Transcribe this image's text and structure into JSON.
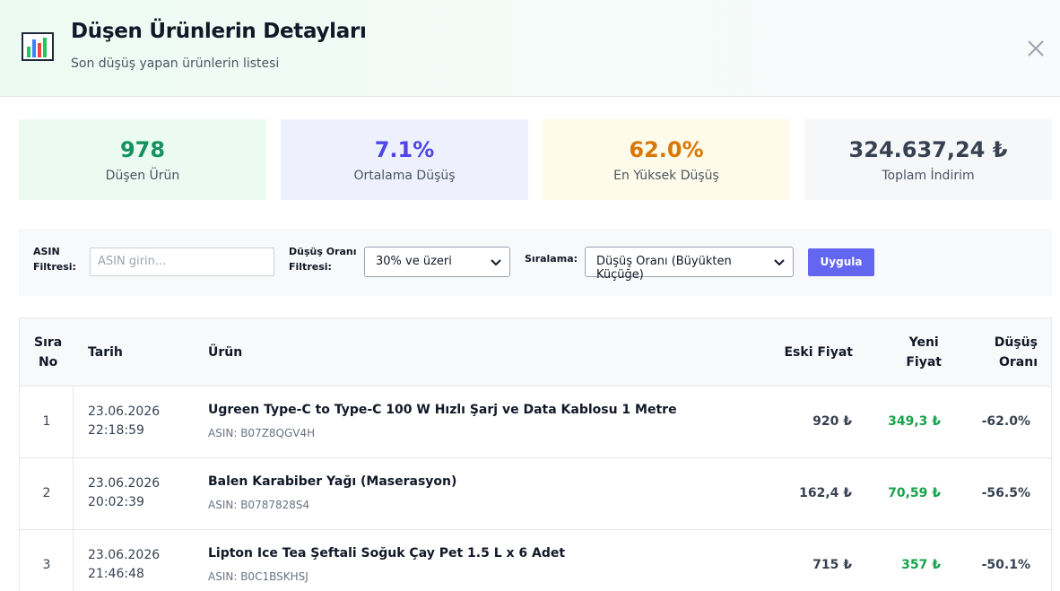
{
  "header": {
    "title": "Düşen Ürünlerin Detayları",
    "subtitle": "Son düşüş yapan ürünlerin listesi",
    "icon": "bar-chart-icon",
    "close_icon": "close-icon"
  },
  "stats": [
    {
      "value": "978",
      "label": "Düşen Ürün",
      "bg": "#ebfbf2",
      "color": "#15925e"
    },
    {
      "value": "7.1%",
      "label": "Ortalama Düşüş",
      "bg": "#eef1fd",
      "color": "#4f46e5"
    },
    {
      "value": "62.0%",
      "label": "En Yüksek Düşüş",
      "bg": "#fefbea",
      "color": "#d97706"
    },
    {
      "value": "324.637,24 ₺",
      "label": "Toplam İndirim",
      "bg": "#f6f7f9",
      "color": "#374151"
    }
  ],
  "filters": {
    "asin_label_1": "ASIN",
    "asin_label_2": "Filtresi:",
    "asin_placeholder": "ASIN girin...",
    "drop_label_1": "Düşüş Oranı",
    "drop_label_2": "Filtresi:",
    "drop_selected": "30% ve üzeri",
    "sort_label": "Sıralama:",
    "sort_selected": "Düşüş Oranı (Büyükten Küçüğe)",
    "apply_label": "Uygula"
  },
  "table": {
    "headers": {
      "no_1": "Sıra",
      "no_2": "No",
      "date": "Tarih",
      "product": "Ürün",
      "old_price": "Eski Fiyat",
      "new_1": "Yeni",
      "new_2": "Fiyat",
      "drop_1": "Düşüş",
      "drop_2": "Oranı"
    },
    "rows": [
      {
        "no": "1",
        "date": "23.06.2026",
        "time": "22:18:59",
        "name": "Ugreen Type-C to Type-C 100 W Hızlı Şarj ve Data Kablosu 1 Metre",
        "asin": "ASIN: B07Z8QGV4H",
        "old": "920 ₺",
        "new": "349,3 ₺",
        "drop": "-62.0%"
      },
      {
        "no": "2",
        "date": "23.06.2026",
        "time": "20:02:39",
        "name": "Balen Karabiber Yağı (Maserasyon)",
        "asin": "ASIN: B0787828S4",
        "old": "162,4 ₺",
        "new": "70,59 ₺",
        "drop": "-56.5%"
      },
      {
        "no": "3",
        "date": "23.06.2026",
        "time": "21:46:48",
        "name": "Lipton Ice Tea Şeftali Soğuk Çay Pet 1.5 L x 6 Adet",
        "asin": "ASIN: B0C1BSKHSJ",
        "old": "715 ₺",
        "new": "357 ₺",
        "drop": "-50.1%"
      }
    ]
  }
}
